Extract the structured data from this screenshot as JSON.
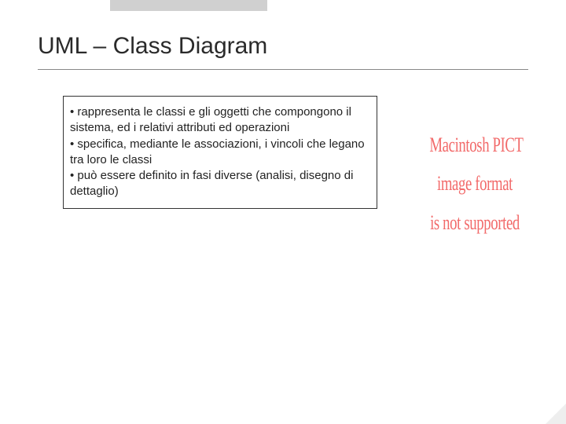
{
  "title": "UML – Class Diagram",
  "bullets": [
    "• rappresenta le classi e gli oggetti che compongono il sistema, ed i relativi attributi ed operazioni",
    "• specifica, mediante le associazioni, i vincoli che legano tra loro le classi",
    "• può essere definito in fasi diverse (analisi, disegno di dettaglio)"
  ],
  "pict": {
    "line1": "Macintosh PICT",
    "line2": "image format",
    "line3": "is not supported"
  }
}
